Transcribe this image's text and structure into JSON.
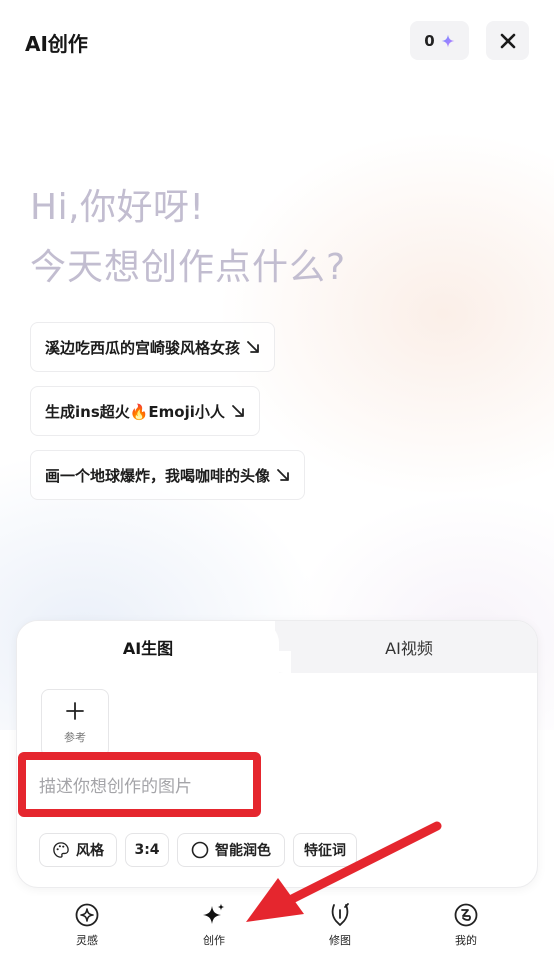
{
  "header": {
    "title": "AI创作",
    "credits": "0"
  },
  "greeting": {
    "line1": "Hi,你好呀!",
    "line2": "今天想创作点什么?"
  },
  "suggestions": [
    {
      "label": "溪边吃西瓜的宫崎骏风格女孩"
    },
    {
      "label": "生成ins超火🔥Emoji小人"
    },
    {
      "label": "画一个地球爆炸，我喝咖啡的头像"
    }
  ],
  "card": {
    "tabs": [
      {
        "label": "AI生图",
        "active": true
      },
      {
        "label": "AI视频",
        "active": false
      }
    ],
    "reference_label": "参考",
    "prompt_placeholder": "描述你想创作的图片",
    "chips": {
      "style": "风格",
      "ratio": "3:4",
      "polish": "智能润色",
      "keywords": "特征词"
    }
  },
  "nav": {
    "items": [
      {
        "label": "灵感",
        "icon": "inspiration-icon"
      },
      {
        "label": "创作",
        "icon": "sparkle-icon"
      },
      {
        "label": "修图",
        "icon": "edit-image-icon"
      },
      {
        "label": "我的",
        "icon": "profile-icon"
      }
    ]
  },
  "colors": {
    "accent_highlight": "#e5262e",
    "greeting_text": "#c2bdd0",
    "sparkle_gradient": [
      "#6a8cff",
      "#c47bff"
    ]
  }
}
